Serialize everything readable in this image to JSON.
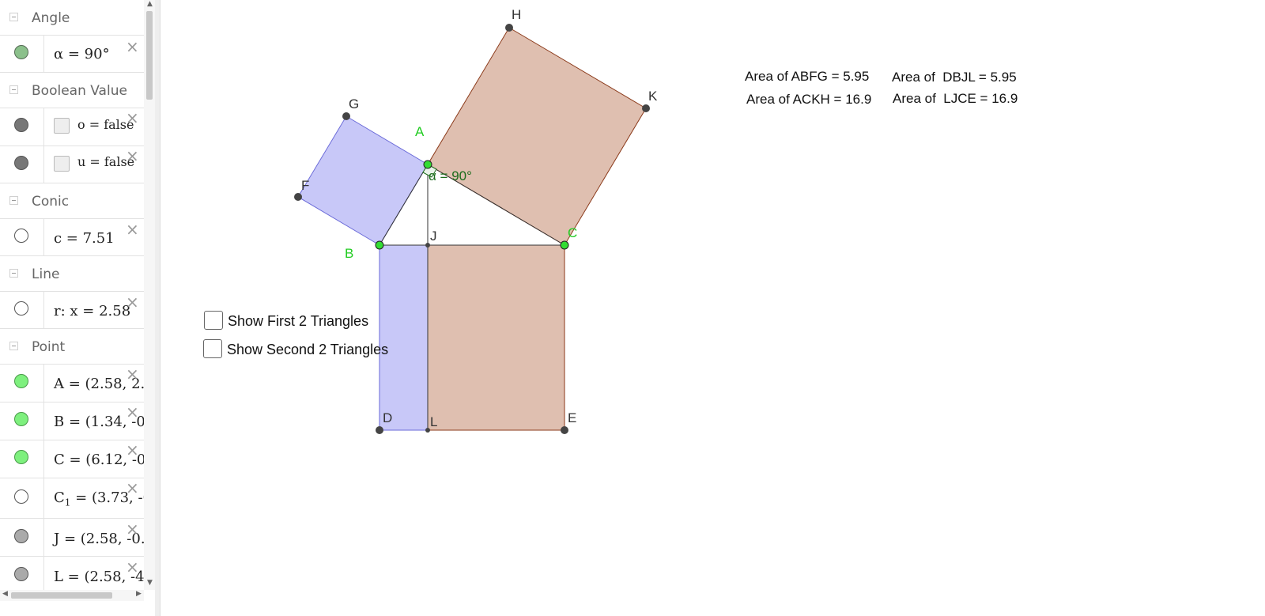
{
  "algebra": {
    "categories": {
      "angle": "Angle",
      "boolean": "Boolean Value",
      "conic": "Conic",
      "line": "Line",
      "point": "Point"
    },
    "items": {
      "alpha": "α = 90°",
      "o": "o = false",
      "u": "u = false",
      "c": "c = 7.51",
      "r": "r: x = 2.58",
      "A": "A = (2.58, 2.0",
      "B": "B = (1.34, -0.",
      "C": "C = (6.12, -0.",
      "C1_name": "C",
      "C1_sub": "1",
      "C1_rest": " = (3.73, -0",
      "J": "J = (2.58, -0.",
      "L": "L = (2.58, -4."
    },
    "delete_glyph": "×"
  },
  "graphics": {
    "checkboxes": {
      "first": "Show First 2 Triangles",
      "second": "Show Second 2 Triangles"
    },
    "areas": {
      "abfg": "Area of ABFG = 5.95",
      "dbjl": "Area of  DBJL = 5.95",
      "ackh": "Area of ACKH = 16.9",
      "ljce": "Area of  LJCE = 16.9"
    },
    "point_labels": {
      "A": "A",
      "B": "B",
      "C": "C",
      "D": "D",
      "E": "E",
      "F": "F",
      "G": "G",
      "H": "H",
      "J": "J",
      "K": "K",
      "L": "L"
    },
    "angle_label": "α = 90°",
    "colors": {
      "blue_fill": "#c8c8f8",
      "brown_fill": "#dfbfb0",
      "brown_stroke": "#8b3a1a",
      "blue_stroke": "#6a6ad8",
      "green_point": "#33dd33",
      "label_green": "#22cc22",
      "angle_green": "#1a6b1a"
    }
  }
}
